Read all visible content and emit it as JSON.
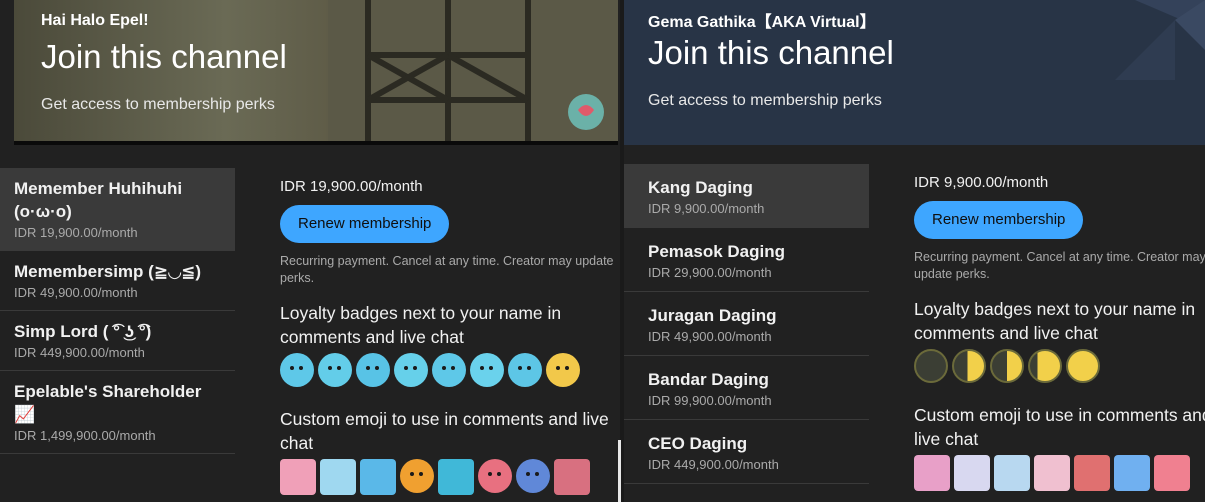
{
  "left": {
    "banner": {
      "creator": "Hai Halo Epel!",
      "join": "Join this channel",
      "perks": "Get access to membership perks"
    },
    "tiers": [
      {
        "name": "Memember Huhihuhi (o·ω·o)",
        "price": "IDR 19,900.00/month"
      },
      {
        "name": "Memembersimp (≧◡≦)",
        "price": "IDR 49,900.00/month"
      },
      {
        "name": "Simp Lord ( ͡° ͜ʖ ͡°)",
        "price": "IDR 449,900.00/month"
      },
      {
        "name": "Epelable's Shareholder 📈",
        "price": "IDR 1,499,900.00/month"
      }
    ],
    "detail": {
      "price": "IDR 19,900.00/month",
      "renew": "Renew membership",
      "recurring": "Recurring payment. Cancel at any time. Creator may update perks.",
      "badges_title": "Loyalty badges next to your name in comments and live chat",
      "emoji_title": "Custom emoji to use in comments and live chat"
    },
    "colors": {
      "badge": "#5ec8e8",
      "accent": "#3ea6ff"
    }
  },
  "right": {
    "banner": {
      "creator": "Gema Gathika【AKA Virtual】",
      "join": "Join this channel",
      "perks": "Get access to membership perks"
    },
    "tiers": [
      {
        "name": "Kang Daging",
        "price": "IDR 9,900.00/month"
      },
      {
        "name": "Pemasok Daging",
        "price": "IDR 29,900.00/month"
      },
      {
        "name": "Juragan Daging",
        "price": "IDR 49,900.00/month"
      },
      {
        "name": "Bandar Daging",
        "price": "IDR 99,900.00/month"
      },
      {
        "name": "CEO Daging",
        "price": "IDR 449,900.00/month"
      }
    ],
    "detail": {
      "price": "IDR 9,900.00/month",
      "renew": "Renew membership",
      "recurring": "Recurring payment. Cancel at any time. Creator may update perks.",
      "badges_title": "Loyalty badges next to your name in comments and live chat",
      "emoji_title": "Custom emoji to use in comments and live chat"
    },
    "colors": {
      "moon": "#f2d04a",
      "accent": "#3ea6ff"
    }
  }
}
